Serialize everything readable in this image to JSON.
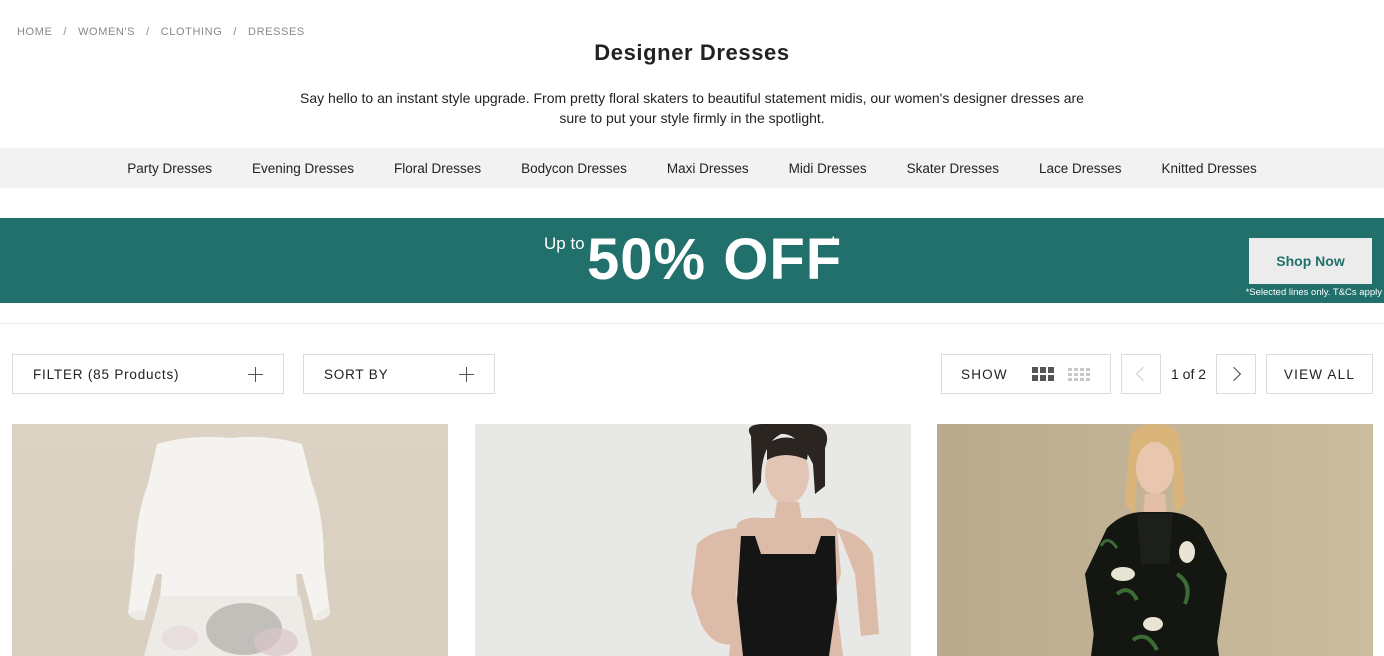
{
  "breadcrumb": [
    "HOME",
    "WOMEN'S",
    "CLOTHING",
    "DRESSES"
  ],
  "breadcrumb_separator": "/",
  "page_title": "Designer Dresses",
  "description": "Say hello to an instant style upgrade. From pretty floral skaters to beautiful statement midis, our women's designer dresses are sure to put your style firmly in the spotlight.",
  "categories": [
    "Party Dresses",
    "Evening Dresses",
    "Floral Dresses",
    "Bodycon Dresses",
    "Maxi Dresses",
    "Midi Dresses",
    "Skater Dresses",
    "Lace Dresses",
    "Knitted Dresses"
  ],
  "promo": {
    "prefix": "Up to",
    "headline": "50% OFF",
    "asterisk": "*",
    "button_label": "Shop Now",
    "terms": "*Selected lines only. T&Cs apply",
    "background_color": "#22706b"
  },
  "toolbar": {
    "filter_label": "FILTER (85 Products)",
    "sort_label": "SORT BY",
    "show_label": "SHOW",
    "page_indicator": "1 of 2",
    "view_all_label": "VIEW ALL",
    "icons": [
      "plus-icon",
      "grid-3-icon",
      "grid-4-icon",
      "chevron-left-icon",
      "chevron-right-icon"
    ]
  },
  "products": [
    {
      "image": "product-image-white-top-floral-skirt"
    },
    {
      "image": "product-image-black-square-neck-dress"
    },
    {
      "image": "product-image-black-floral-maxi-dress"
    }
  ]
}
